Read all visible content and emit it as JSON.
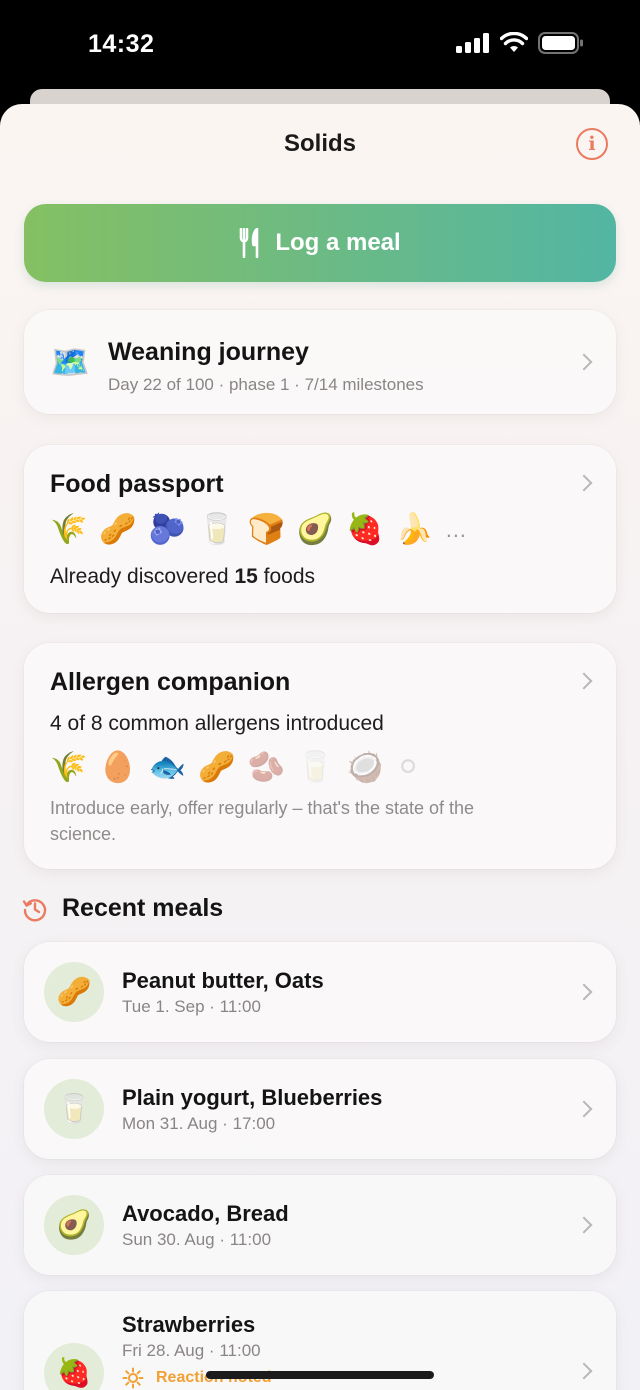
{
  "status": {
    "time": "14:32"
  },
  "header": {
    "title": "Solids",
    "info_icon": "info-icon"
  },
  "log_button": {
    "label": "Log a meal",
    "icon": "fork-knife-icon"
  },
  "journey": {
    "icon": "🗺️",
    "title": "Weaning journey",
    "subtitle": "Day 22 of 100 · phase 1 · 7/14 milestones"
  },
  "passport": {
    "title": "Food passport",
    "foods": [
      "🌾",
      "🥜",
      "🫐",
      "🥛",
      "🍞",
      "🥑",
      "🍓",
      "🍌"
    ],
    "more": "…",
    "discovered_prefix": "Already discovered ",
    "discovered_count": "15",
    "discovered_suffix": " foods"
  },
  "allergen": {
    "title": "Allergen companion",
    "summary": "4 of 8 common allergens introduced",
    "allergens": [
      "🌾",
      "🥚",
      "🐟",
      "🥜",
      "🫘",
      "🥛",
      "🥥",
      "⚪"
    ],
    "note": "Introduce early, offer regularly – that's the state of the science."
  },
  "recent": {
    "title": "Recent meals",
    "icon": "history-icon",
    "meals": [
      {
        "emoji": "🥜",
        "title": "Peanut butter, Oats",
        "subtitle": "Tue 1. Sep · 11:00"
      },
      {
        "emoji": "🥛",
        "title": "Plain yogurt, Blueberries",
        "subtitle": "Mon 31. Aug · 17:00"
      },
      {
        "emoji": "🥑",
        "title": "Avocado, Bread",
        "subtitle": "Sun 30. Aug · 11:00"
      },
      {
        "emoji": "🍓",
        "title": "Strawberries",
        "subtitle": "Fri 28. Aug · 11:00",
        "reaction": "Reaction noted"
      }
    ]
  },
  "colors": {
    "accent": "#ea7b61",
    "gradient_start": "#85c062",
    "gradient_end": "#52b6a3",
    "reaction": "#f1a033"
  }
}
